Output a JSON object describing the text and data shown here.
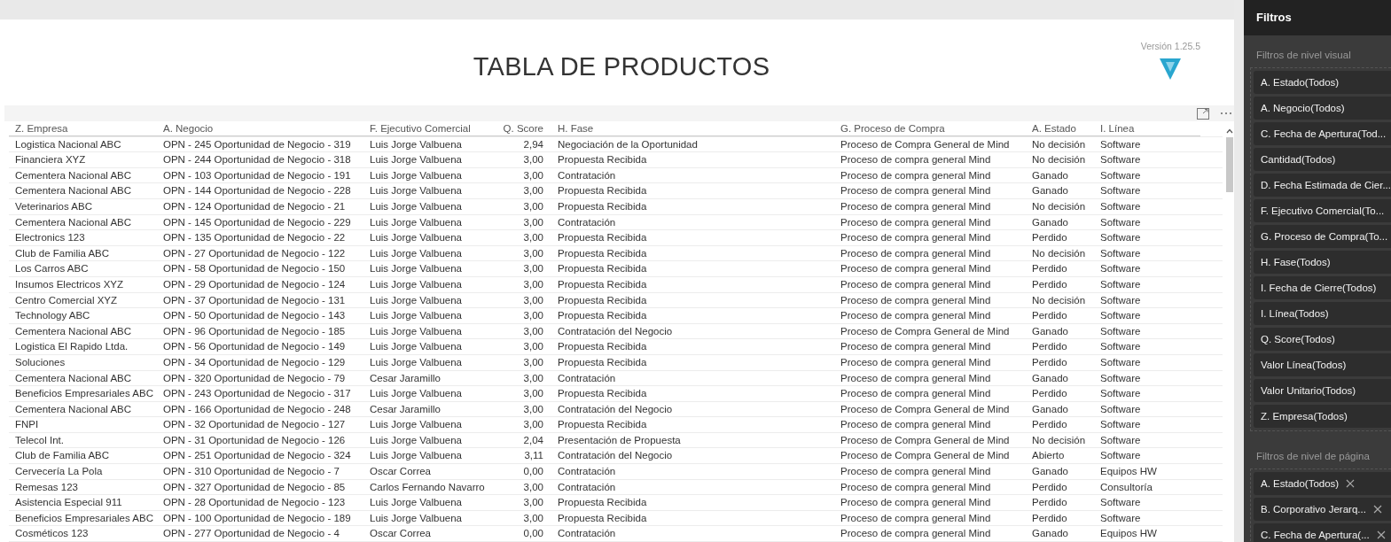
{
  "report": {
    "title": "TABLA DE PRODUCTOS",
    "version": "Versión 1.25.5"
  },
  "table": {
    "columns": [
      "Z. Empresa",
      "A. Negocio",
      "F. Ejecutivo Comercial",
      "Q. Score",
      "H. Fase",
      "G. Proceso de Compra",
      "A. Estado",
      "I. Línea"
    ],
    "rows": [
      [
        "Logistica Nacional ABC",
        "OPN - 245 Oportunidad de Negocio - 319",
        "Luis Jorge Valbuena",
        "2,94",
        "Negociación de la Oportunidad",
        "Proceso de Compra General de Mind",
        "No decisión",
        "Software"
      ],
      [
        "Financiera XYZ",
        "OPN - 244 Oportunidad de Negocio - 318",
        "Luis Jorge Valbuena",
        "3,00",
        "Propuesta Recibida",
        "Proceso de compra general Mind",
        "No decisión",
        "Software"
      ],
      [
        "Cementera Nacional ABC",
        "OPN - 103 Oportunidad de Negocio - 191",
        "Luis Jorge Valbuena",
        "3,00",
        "Contratación",
        "Proceso de compra general Mind",
        "Ganado",
        "Software"
      ],
      [
        "Cementera Nacional ABC",
        "OPN - 144 Oportunidad de Negocio - 228",
        "Luis Jorge Valbuena",
        "3,00",
        "Propuesta Recibida",
        "Proceso de compra general Mind",
        "Ganado",
        "Software"
      ],
      [
        "Veterinarios ABC",
        "OPN - 124 Oportunidad de Negocio - 21",
        "Luis Jorge Valbuena",
        "3,00",
        "Propuesta Recibida",
        "Proceso de compra general Mind",
        "No decisión",
        "Software"
      ],
      [
        "Cementera Nacional ABC",
        "OPN - 145 Oportunidad de Negocio - 229",
        "Luis Jorge Valbuena",
        "3,00",
        "Contratación",
        "Proceso de compra general Mind",
        "Ganado",
        "Software"
      ],
      [
        "Electronics 123",
        "OPN - 135 Oportunidad de Negocio - 22",
        "Luis Jorge Valbuena",
        "3,00",
        "Propuesta Recibida",
        "Proceso de compra general Mind",
        "Perdido",
        "Software"
      ],
      [
        "Club de Familia ABC",
        "OPN - 27 Oportunidad de Negocio - 122",
        "Luis Jorge Valbuena",
        "3,00",
        "Propuesta Recibida",
        "Proceso de compra general Mind",
        "No decisión",
        "Software"
      ],
      [
        "Los Carros ABC",
        "OPN - 58 Oportunidad de Negocio - 150",
        "Luis Jorge Valbuena",
        "3,00",
        "Propuesta Recibida",
        "Proceso de compra general Mind",
        "Perdido",
        "Software"
      ],
      [
        "Insumos Electricos XYZ",
        "OPN - 29 Oportunidad de Negocio - 124",
        "Luis Jorge Valbuena",
        "3,00",
        "Propuesta Recibida",
        "Proceso de compra general Mind",
        "Perdido",
        "Software"
      ],
      [
        "Centro Comercial XYZ",
        "OPN - 37 Oportunidad de Negocio - 131",
        "Luis Jorge Valbuena",
        "3,00",
        "Propuesta Recibida",
        "Proceso de compra general Mind",
        "No decisión",
        "Software"
      ],
      [
        "Technology ABC",
        "OPN - 50 Oportunidad de Negocio - 143",
        "Luis Jorge Valbuena",
        "3,00",
        "Propuesta Recibida",
        "Proceso de compra general Mind",
        "Perdido",
        "Software"
      ],
      [
        "Cementera Nacional ABC",
        "OPN - 96 Oportunidad de Negocio - 185",
        "Luis Jorge Valbuena",
        "3,00",
        "Contratación del Negocio",
        "Proceso de Compra General de Mind",
        "Ganado",
        "Software"
      ],
      [
        "Logistica El Rapido Ltda.",
        "OPN - 56 Oportunidad de Negocio - 149",
        "Luis Jorge Valbuena",
        "3,00",
        "Propuesta Recibida",
        "Proceso de compra general Mind",
        "Perdido",
        "Software"
      ],
      [
        "Soluciones",
        "OPN - 34 Oportunidad de Negocio - 129",
        "Luis Jorge Valbuena",
        "3,00",
        "Propuesta Recibida",
        "Proceso de compra general Mind",
        "Perdido",
        "Software"
      ],
      [
        "Cementera Nacional ABC",
        "OPN - 320 Oportunidad de Negocio - 79",
        "Cesar Jaramillo",
        "3,00",
        "Contratación",
        "Proceso de compra general Mind",
        "Ganado",
        "Software"
      ],
      [
        "Beneficios Empresariales ABC",
        "OPN - 243 Oportunidad de Negocio - 317",
        "Luis Jorge Valbuena",
        "3,00",
        "Propuesta Recibida",
        "Proceso de compra general Mind",
        "Perdido",
        "Software"
      ],
      [
        "Cementera Nacional ABC",
        "OPN - 166 Oportunidad de Negocio - 248",
        "Cesar Jaramillo",
        "3,00",
        "Contratación del Negocio",
        "Proceso de Compra General de Mind",
        "Ganado",
        "Software"
      ],
      [
        "FNPI",
        "OPN - 32 Oportunidad de Negocio - 127",
        "Luis Jorge Valbuena",
        "3,00",
        "Propuesta Recibida",
        "Proceso de compra general Mind",
        "Perdido",
        "Software"
      ],
      [
        "Telecol Int.",
        "OPN - 31 Oportunidad de Negocio - 126",
        "Luis Jorge Valbuena",
        "2,04",
        "Presentación de Propuesta",
        "Proceso de Compra General de Mind",
        "No decisión",
        "Software"
      ],
      [
        "Club de Familia ABC",
        "OPN - 251 Oportunidad de Negocio - 324",
        "Luis Jorge Valbuena",
        "3,11",
        "Contratación del Negocio",
        "Proceso de Compra General de Mind",
        "Abierto",
        "Software"
      ],
      [
        "Cervecería La Pola",
        "OPN - 310 Oportunidad de Negocio - 7",
        "Oscar Correa",
        "0,00",
        "Contratación",
        "Proceso de compra general Mind",
        "Ganado",
        "Equipos HW"
      ],
      [
        "Remesas 123",
        "OPN - 327 Oportunidad de Negocio - 85",
        "Carlos Fernando Navarro",
        "3,00",
        "Contratación",
        "Proceso de compra general Mind",
        "Perdido",
        "Consultoría"
      ],
      [
        "Asistencia Especial 911",
        "OPN - 28 Oportunidad de Negocio - 123",
        "Luis Jorge Valbuena",
        "3,00",
        "Propuesta Recibida",
        "Proceso de compra general Mind",
        "Perdido",
        "Software"
      ],
      [
        "Beneficios Empresariales ABC",
        "OPN - 100 Oportunidad de Negocio - 189",
        "Luis Jorge Valbuena",
        "3,00",
        "Propuesta Recibida",
        "Proceso de compra general Mind",
        "Perdido",
        "Software"
      ],
      [
        "Cosméticos 123",
        "OPN - 277 Oportunidad de Negocio - 4",
        "Oscar Correa",
        "0,00",
        "Contratación",
        "Proceso de compra general Mind",
        "Ganado",
        "Equipos HW"
      ]
    ]
  },
  "filters_pane": {
    "title": "Filtros",
    "sections": [
      {
        "title": "Filtros de nivel visual",
        "items": [
          {
            "label": "A. Estado(Todos)",
            "removable": false
          },
          {
            "label": "A. Negocio(Todos)",
            "removable": false
          },
          {
            "label": "C. Fecha de Apertura(Tod...",
            "removable": false
          },
          {
            "label": "Cantidad(Todos)",
            "removable": false
          },
          {
            "label": "D. Fecha Estimada de Cier...",
            "removable": false
          },
          {
            "label": "F. Ejecutivo Comercial(To...",
            "removable": false
          },
          {
            "label": "G. Proceso de Compra(To...",
            "removable": false
          },
          {
            "label": "H. Fase(Todos)",
            "removable": false
          },
          {
            "label": "I. Fecha de Cierre(Todos)",
            "removable": false
          },
          {
            "label": "I. Línea(Todos)",
            "removable": false
          },
          {
            "label": "Q. Score(Todos)",
            "removable": false
          },
          {
            "label": "Valor Línea(Todos)",
            "removable": false
          },
          {
            "label": "Valor Unitario(Todos)",
            "removable": false
          },
          {
            "label": "Z. Empresa(Todos)",
            "removable": false
          }
        ]
      },
      {
        "title": "Filtros de nivel de página",
        "items": [
          {
            "label": "A. Estado(Todos)",
            "removable": true
          },
          {
            "label": "B. Corporativo Jerarq...",
            "removable": true
          },
          {
            "label": "C. Fecha de Apertura(...",
            "removable": true
          }
        ]
      }
    ]
  }
}
